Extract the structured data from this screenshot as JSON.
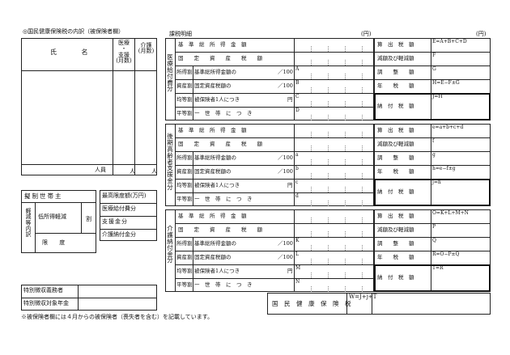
{
  "left": {
    "section_title": "◎国民健康保険税の内訳（被保険者欄）",
    "name_header": "氏 名",
    "medical_header": "医療\n・\n支援\n(月数)",
    "care_header": "介護\n(月数)",
    "person_unit": "人員",
    "count_unit_1": "人",
    "count_unit_2": "人"
  },
  "middle": {
    "deduction_head": "擬制世帯主",
    "reduction_group": "軽減等内訳",
    "low_income": "低所得軽減",
    "split": "割",
    "limit": "限 度",
    "max_limit": "最高限度額(万円)",
    "medical_pay": "医療給付費分",
    "support_pay": "支援金分",
    "care_pay": "介護納付金分"
  },
  "special": {
    "obligor": "特別徴収義務者",
    "target_pension": "特別徴収対象年金"
  },
  "footnote": "※被保険者欄には４月からの被保険者（喪失者を含む）を記載しています。",
  "calc": {
    "title": "課税明細",
    "unit_en_1": "(円)",
    "unit_en_2": "(円)",
    "sections": [
      {
        "label": "医療給付費分",
        "rows": [
          {
            "cat": "",
            "desc": "基　準　総　所　得　金　額",
            "unit": "",
            "ref": ""
          },
          {
            "cat": "",
            "desc": "固　　定　　資　　産　　税　　額",
            "unit": "",
            "ref": ""
          },
          {
            "cat": "所得割",
            "desc": "基準総所得金額の",
            "unit": "／100",
            "ref": "A"
          },
          {
            "cat": "資産割",
            "desc": "固定資産税額の",
            "unit": "／100",
            "ref": "B"
          },
          {
            "cat": "均等割",
            "desc": "被保険者1人につき",
            "unit": "円",
            "ref": "C"
          },
          {
            "cat": "平等割",
            "desc": "一　世　帯　に　つ　き",
            "unit": "",
            "ref": "D"
          }
        ],
        "right": [
          {
            "label": "算　出　税　額",
            "formula": "E=A+B+C+D"
          },
          {
            "label": "減額及び軽減額",
            "formula": "F"
          },
          {
            "label": "調　　整　　額",
            "formula": "G"
          },
          {
            "label": "年　　税　　額",
            "formula": "H=E−F±G"
          },
          {
            "label": "納　付　税　額",
            "formula": "J=H"
          }
        ]
      },
      {
        "label": "後期高齢者支援金分",
        "rows": [
          {
            "cat": "",
            "desc": "基　準　総　所　得　金　額",
            "unit": "",
            "ref": ""
          },
          {
            "cat": "",
            "desc": "固　　定　　資　　産　　税　　額",
            "unit": "",
            "ref": ""
          },
          {
            "cat": "所得割",
            "desc": "基準総所得金額の",
            "unit": "／100",
            "ref": "a"
          },
          {
            "cat": "資産割",
            "desc": "固定資産税額の",
            "unit": "／100",
            "ref": "b"
          },
          {
            "cat": "均等割",
            "desc": "被保険者1人につき",
            "unit": "円",
            "ref": "c"
          },
          {
            "cat": "平等割",
            "desc": "一　世　帯　に　つ　き",
            "unit": "",
            "ref": "d"
          }
        ],
        "right": [
          {
            "label": "算　出　税　額",
            "formula": "e=a+b+c+d"
          },
          {
            "label": "減額及び軽減額",
            "formula": "f"
          },
          {
            "label": "調　　整　　額",
            "formula": "g"
          },
          {
            "label": "年　　税　　額",
            "formula": "h=e−f±g"
          },
          {
            "label": "納　付　税　額",
            "formula": "j=h"
          }
        ]
      },
      {
        "label": "介護納付金分",
        "rows": [
          {
            "cat": "",
            "desc": "基　準　総　所　得　金　額",
            "unit": "",
            "ref": ""
          },
          {
            "cat": "",
            "desc": "固　　定　　資　　産　　税　　額",
            "unit": "",
            "ref": ""
          },
          {
            "cat": "所得割",
            "desc": "基準総所得金額の",
            "unit": "／100",
            "ref": "K"
          },
          {
            "cat": "資産割",
            "desc": "固定資産税額の",
            "unit": "／100",
            "ref": "L"
          },
          {
            "cat": "均等割",
            "desc": "被保険者1人につき",
            "unit": "円",
            "ref": "M"
          },
          {
            "cat": "平等割",
            "desc": "一　世　帯　に　つ　き",
            "unit": "",
            "ref": "N"
          }
        ],
        "right": [
          {
            "label": "算　出　税　額",
            "formula": "O=K+L+M+N"
          },
          {
            "label": "減額及び軽減額",
            "formula": "P"
          },
          {
            "label": "調　　整　　額",
            "formula": "Q"
          },
          {
            "label": "年　　税　　額",
            "formula": "R=O−P±Q"
          },
          {
            "label": "納　付　税　額",
            "formula": "T=R"
          }
        ]
      }
    ],
    "total_label": "国　民　健　康　保　険　税",
    "total_formula": "W=J+j+T"
  }
}
